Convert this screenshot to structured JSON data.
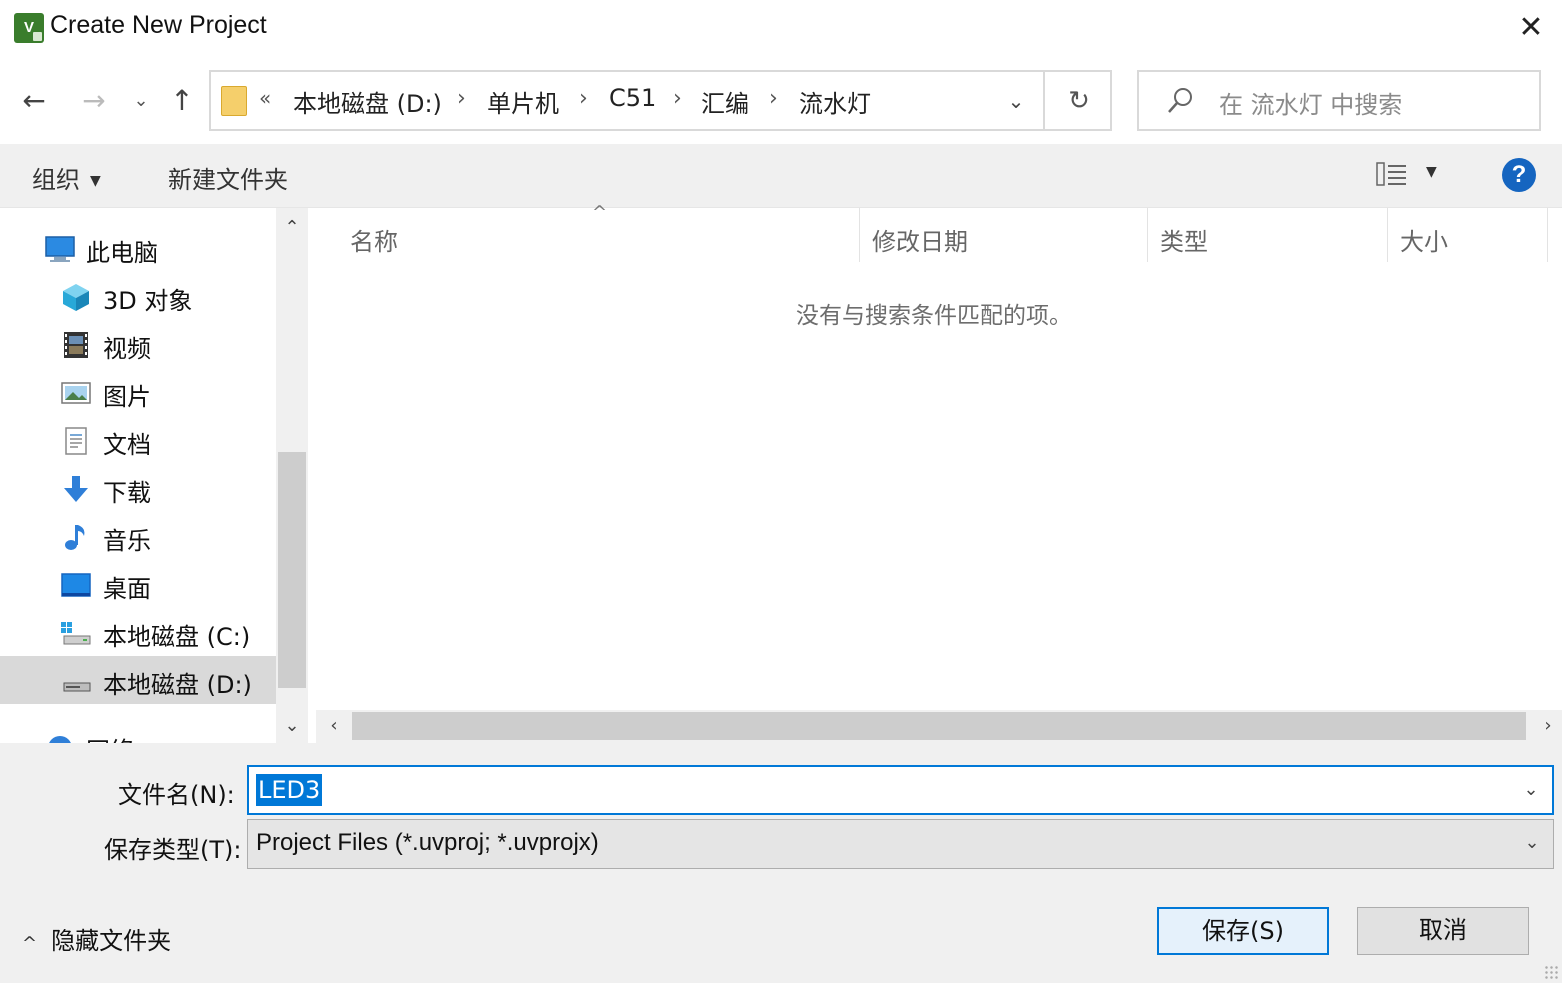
{
  "window": {
    "title": "Create New Project",
    "app_icon_text": "V",
    "close_glyph": "✕"
  },
  "nav": {
    "back_glyph": "←",
    "forward_glyph": "→",
    "recent_glyph": "⌄",
    "up_glyph": "↑"
  },
  "address": {
    "overflow": "«",
    "crumbs": [
      "本地磁盘 (D:)",
      "单片机",
      "C51",
      "汇编",
      "流水灯"
    ],
    "separator": "›",
    "dropdown_glyph": "⌄",
    "refresh_glyph": "↻"
  },
  "search": {
    "placeholder": "在 流水灯 中搜索"
  },
  "toolbar": {
    "organize_label": "组织",
    "organize_caret": "▼",
    "new_folder_label": "新建文件夹",
    "view_caret": "▼",
    "help_glyph": "?"
  },
  "tree": {
    "items": [
      {
        "label": "此电脑",
        "icon": "computer-icon"
      },
      {
        "label": "3D 对象",
        "icon": "3d-objects-icon"
      },
      {
        "label": "视频",
        "icon": "videos-icon"
      },
      {
        "label": "图片",
        "icon": "pictures-icon"
      },
      {
        "label": "文档",
        "icon": "documents-icon"
      },
      {
        "label": "下载",
        "icon": "downloads-icon"
      },
      {
        "label": "音乐",
        "icon": "music-icon"
      },
      {
        "label": "桌面",
        "icon": "desktop-icon"
      },
      {
        "label": "本地磁盘 (C:)",
        "icon": "drive-c-icon"
      },
      {
        "label": "本地磁盘 (D:)",
        "icon": "drive-d-icon",
        "selected": true
      },
      {
        "label": "网络",
        "icon": "network-icon"
      }
    ]
  },
  "scrollbars": {
    "up_glyph": "⌃",
    "down_glyph": "⌄",
    "left_glyph": "‹",
    "right_glyph": "›"
  },
  "list": {
    "sort_glyph": "^",
    "columns": [
      "名称",
      "修改日期",
      "类型",
      "大小"
    ],
    "empty_message": "没有与搜索条件匹配的项。"
  },
  "form": {
    "filename_label": "文件名(N):",
    "filename_value": "LED3",
    "filetype_label": "保存类型(T):",
    "filetype_value": "Project Files (*.uvproj; *.uvprojx)",
    "dropdown_glyph": "⌄"
  },
  "footer": {
    "hide_folders_glyph": "^",
    "hide_folders_label": "隐藏文件夹",
    "save_label": "保存(S)",
    "cancel_label": "取消"
  },
  "colors": {
    "accent": "#0078d7",
    "selection": "#d9d9d9",
    "help": "#1565c0",
    "folder": "#f5cf6b"
  }
}
